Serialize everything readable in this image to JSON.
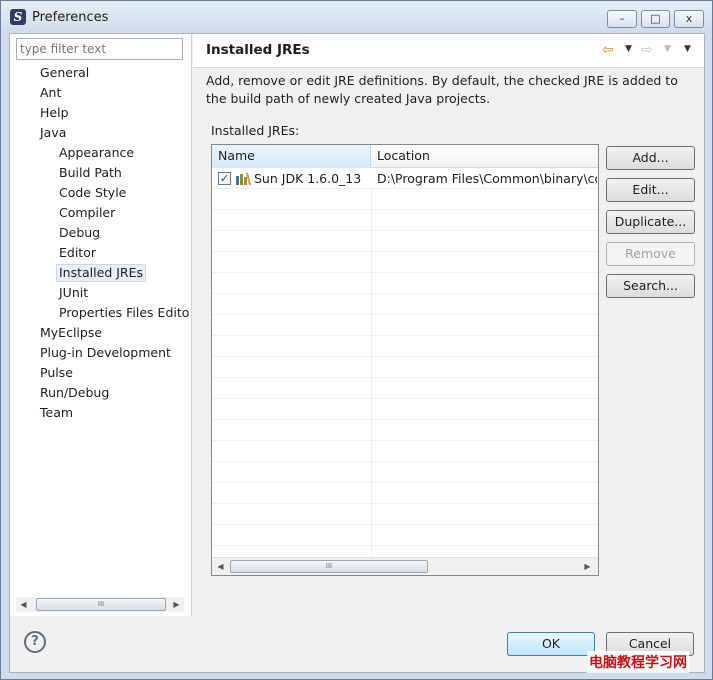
{
  "window": {
    "title": "Preferences",
    "controls": {
      "minimize": "–",
      "maximize": "□",
      "close": "x"
    }
  },
  "filter": {
    "placeholder": "type filter text"
  },
  "tree": {
    "items": [
      {
        "label": "General"
      },
      {
        "label": "Ant"
      },
      {
        "label": "Help"
      },
      {
        "label": "Java"
      },
      {
        "label": "Appearance"
      },
      {
        "label": "Build Path"
      },
      {
        "label": "Code Style"
      },
      {
        "label": "Compiler"
      },
      {
        "label": "Debug"
      },
      {
        "label": "Editor"
      },
      {
        "label": "Installed JREs",
        "selected": true
      },
      {
        "label": "JUnit"
      },
      {
        "label": "Properties Files Edito"
      },
      {
        "label": "MyEclipse"
      },
      {
        "label": "Plug-in Development"
      },
      {
        "label": "Pulse"
      },
      {
        "label": "Run/Debug"
      },
      {
        "label": "Team"
      }
    ]
  },
  "page": {
    "title": "Installed JREs",
    "description": "Add, remove or edit JRE definitions. By default, the checked JRE is added to the build path of newly created Java projects.",
    "list_label": "Installed JREs:"
  },
  "table": {
    "columns": [
      "Name",
      "Location"
    ],
    "rows": [
      {
        "checked": true,
        "name": "Sun JDK 1.6.0_13",
        "location": "D:\\Program Files\\Common\\binary\\com"
      }
    ]
  },
  "buttons": {
    "add": "Add...",
    "edit": "Edit...",
    "duplicate": "Duplicate...",
    "remove": "Remove",
    "search": "Search..."
  },
  "footer": {
    "help": "?",
    "ok": "OK",
    "cancel": "Cancel"
  },
  "watermark": "电脑教程学习网",
  "colors": {
    "accent": "#3c7fb1",
    "selection": "#e8eff8",
    "nav_arrow": "#c99a22",
    "watermark": "#d01010"
  }
}
